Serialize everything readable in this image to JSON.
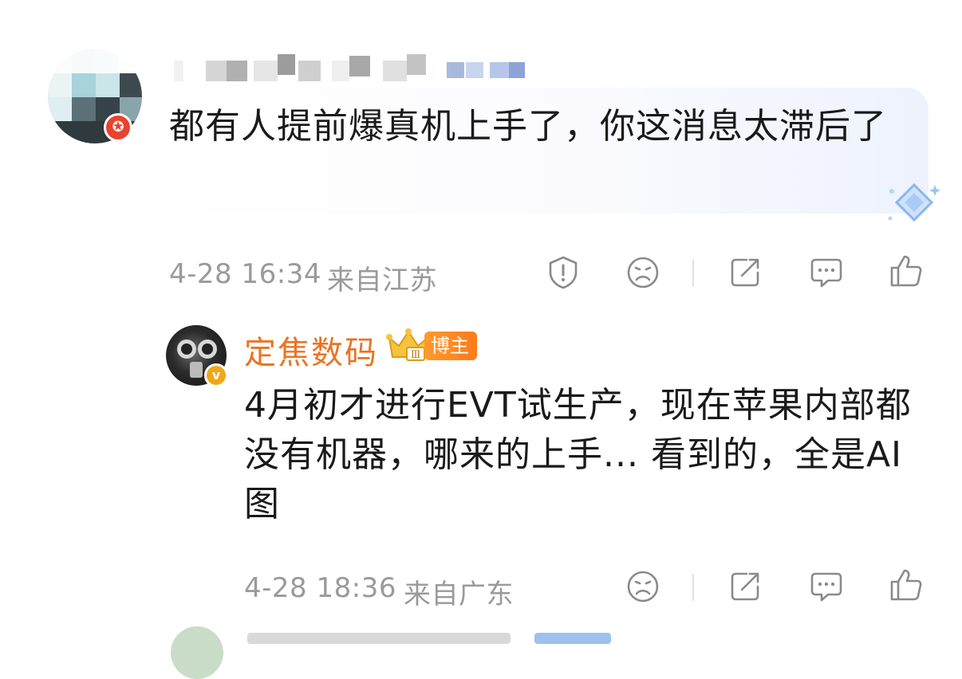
{
  "comment": {
    "text": "都有人提前爆真机上手了，你这消息太滞后了",
    "time": "4-28 16:34",
    "location": "来自江苏",
    "user_badge_icon": "red-star-badge",
    "actions": [
      "report-icon",
      "sad-face-icon",
      "share-icon",
      "comment-icon",
      "like-icon"
    ]
  },
  "reply": {
    "username": "定焦数码",
    "badge_label": "博主",
    "crown_rank": "Ⅲ",
    "verified_mark": "v",
    "text": "4月初才进行EVT试生产，现在苹果内部都没有机器，哪来的上手... 看到的，全是AI图",
    "time": "4-28 18:36",
    "location": "来自广东",
    "actions": [
      "sad-face-icon",
      "share-icon",
      "comment-icon",
      "like-icon"
    ]
  },
  "colors": {
    "username": "#eb7323",
    "meta_text": "#9a9a9a",
    "badge_orange": "#ff8a24",
    "red_badge": "#e8432f"
  }
}
